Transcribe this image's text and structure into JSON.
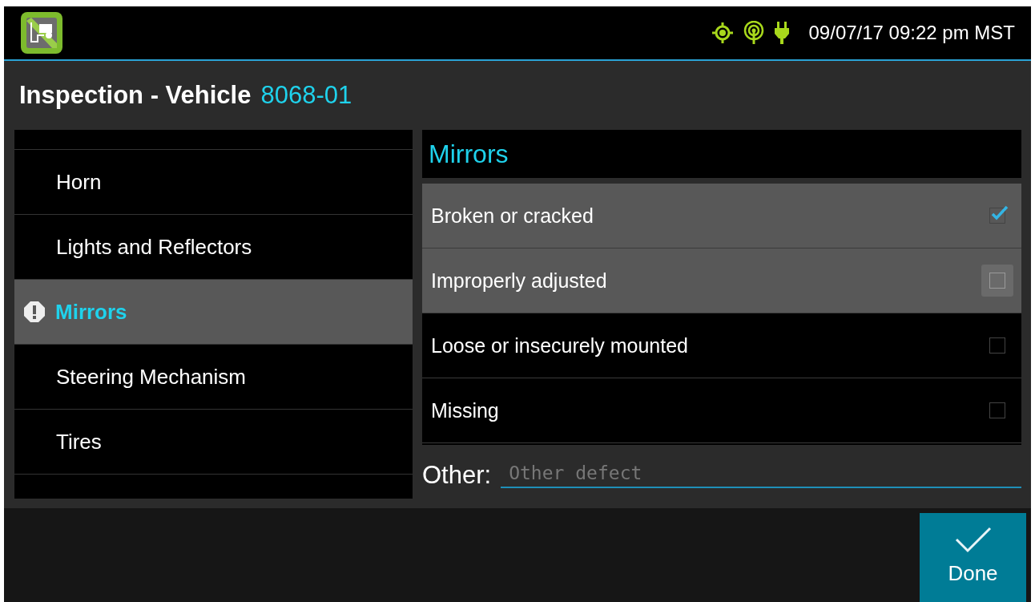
{
  "status_bar": {
    "datetime": "09/07/17 09:22 pm MST"
  },
  "header": {
    "title": "Inspection - Vehicle",
    "vehicle": "8068-01"
  },
  "categories": [
    {
      "label": "Horn",
      "selected": false,
      "warning": false
    },
    {
      "label": "Lights and Reflectors",
      "selected": false,
      "warning": false
    },
    {
      "label": "Mirrors",
      "selected": true,
      "warning": true
    },
    {
      "label": "Steering Mechanism",
      "selected": false,
      "warning": false
    },
    {
      "label": "Tires",
      "selected": false,
      "warning": false
    }
  ],
  "defects_panel": {
    "title": "Mirrors",
    "defects": [
      {
        "label": "Broken or cracked",
        "checked": true,
        "focused": false
      },
      {
        "label": "Improperly adjusted",
        "checked": false,
        "focused": true
      },
      {
        "label": "Loose or insecurely mounted",
        "checked": false,
        "focused": false
      },
      {
        "label": "Missing",
        "checked": false,
        "focused": false
      }
    ]
  },
  "other": {
    "label": "Other:",
    "placeholder": "Other defect"
  },
  "done_button": {
    "label": "Done"
  }
}
